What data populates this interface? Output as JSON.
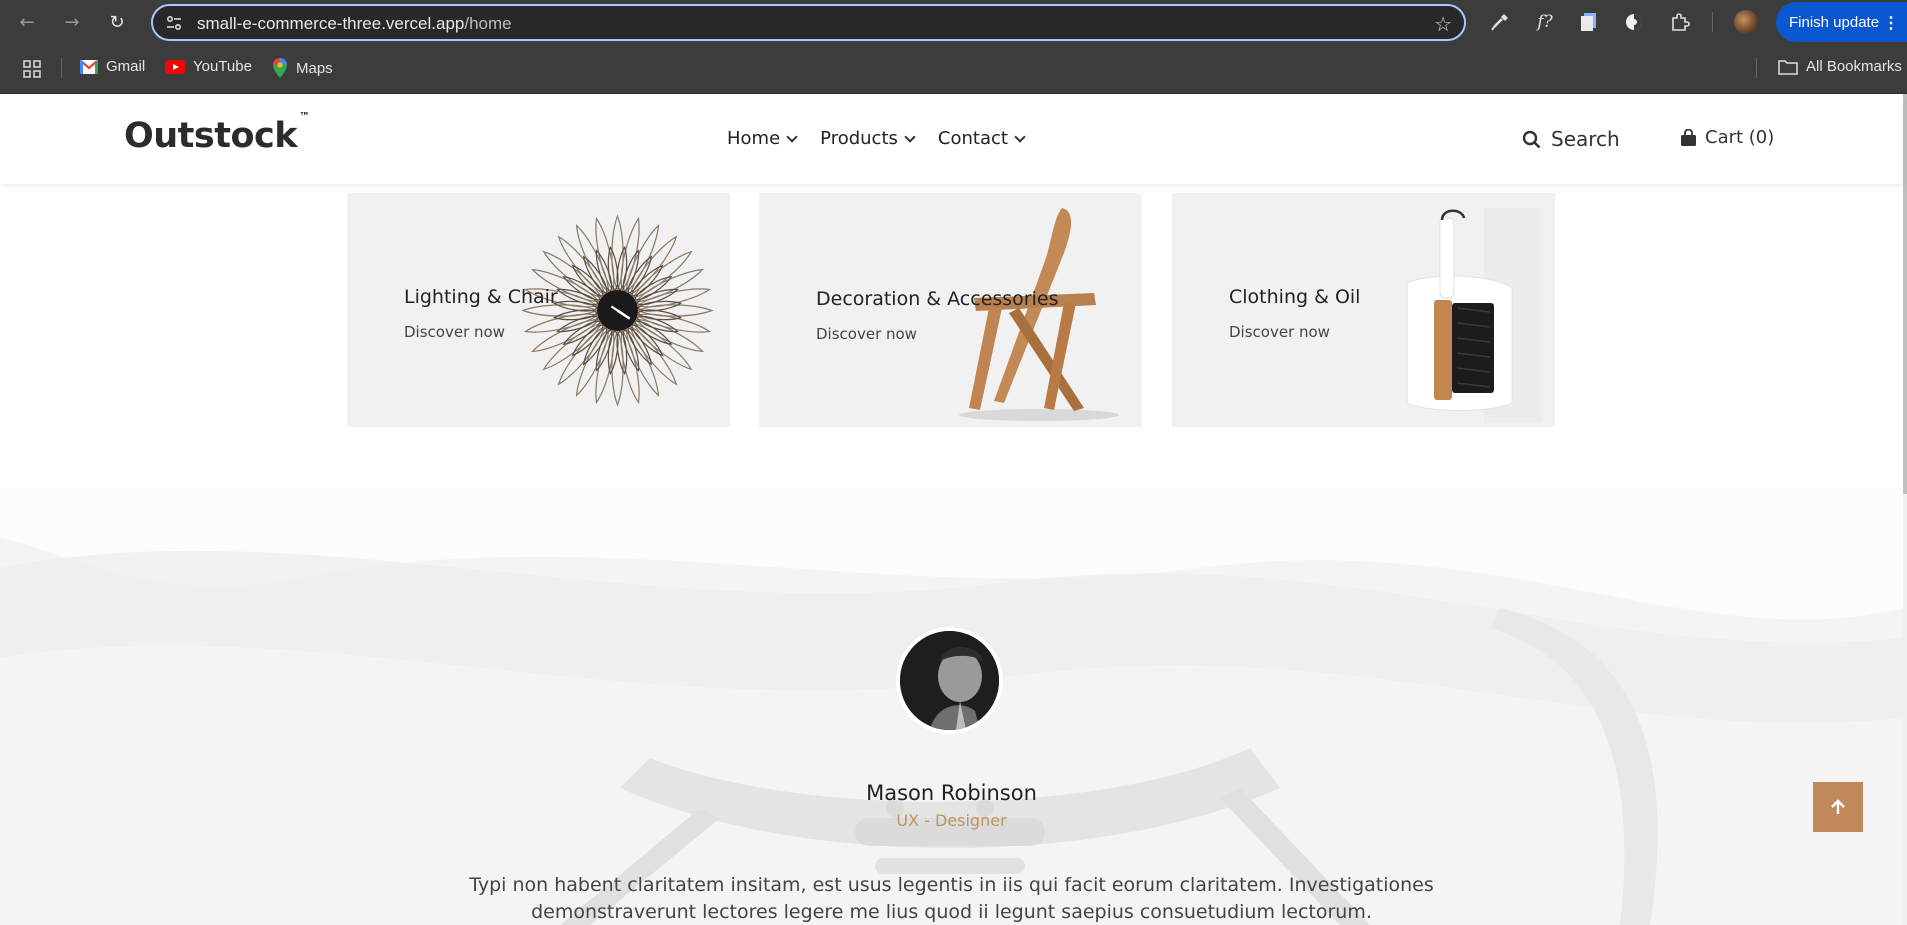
{
  "browser": {
    "url_host": "small-e-commerce-three.vercel.app",
    "url_path": "/home",
    "finish_update_label": "Finish update",
    "bookmarks": [
      {
        "label": "Gmail",
        "icon": "gmail-icon"
      },
      {
        "label": "YouTube",
        "icon": "youtube-icon"
      },
      {
        "label": "Maps",
        "icon": "maps-icon"
      }
    ],
    "all_bookmarks_label": "All Bookmarks",
    "ext_label_fx": "f?"
  },
  "site": {
    "logo": "Outstock",
    "logo_mark": "™",
    "menu": [
      {
        "label": "Home"
      },
      {
        "label": "Products"
      },
      {
        "label": "Contact"
      }
    ],
    "search_label": "Search",
    "cart_label": "Cart (0)"
  },
  "categories": [
    {
      "title": "Lighting & Chair",
      "link": "Discover now",
      "icon": "sunburst-clock"
    },
    {
      "title": "Decoration & Accessories",
      "link": "Discover now",
      "icon": "wooden-chair"
    },
    {
      "title": "Clothing & Oil",
      "link": "Discover now",
      "icon": "dustpan-brush"
    }
  ],
  "testimonial": {
    "name": "Mason Robinson",
    "role": "UX - Designer",
    "quote": "Typi non habent claritatem insitam, est usus legentis in iis qui facit eorum claritatem. Investigationes demonstraverunt lectores legere me lius quod ii legunt saepius consuetudium lectorum."
  },
  "colors": {
    "accent": "#c0895a",
    "role_text": "#c0935f",
    "chrome_bg": "#3c3c3c",
    "update_button": "#0b57d0"
  }
}
